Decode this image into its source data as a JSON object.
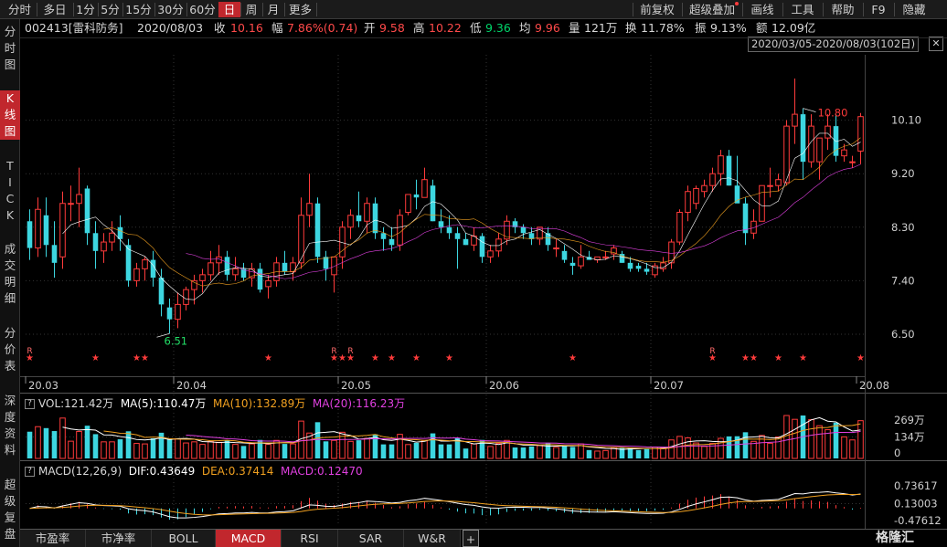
{
  "toolbar": {
    "period_tabs": [
      "分时",
      "多日",
      "1分",
      "5分",
      "15分",
      "30分",
      "60分",
      "日",
      "周",
      "月",
      "更多"
    ],
    "active_tab": "日",
    "right_buttons": [
      "前复权",
      "超级叠加",
      "画线",
      "工具",
      "帮助",
      "F9",
      "隐藏"
    ]
  },
  "sidebar": {
    "groups": [
      "分时图",
      "K线图",
      "TICK",
      "成交明细",
      "分价表",
      "深度资料",
      "超级复盘"
    ],
    "active": "K线图"
  },
  "quote": {
    "code_name": "002413[雷科防务]",
    "date": "2020/08/03",
    "close_label": "收",
    "close": "10.16",
    "change_label": "幅",
    "change": "7.86%(0.74)",
    "open_label": "开",
    "open": "9.58",
    "high_label": "高",
    "high": "10.22",
    "low_label": "低",
    "low": "9.36",
    "avg_label": "均",
    "avg": "9.96",
    "volume_label": "量",
    "volume": "121万",
    "turnover_label": "换",
    "turnover": "11.78%",
    "amplitude_label": "振",
    "amplitude": "9.13%",
    "amount_label": "额",
    "amount": "12.09亿"
  },
  "range_label": "2020/03/05-2020/08/03(102日)",
  "range_close_glyph": "✕",
  "colors": {
    "up": "#ff3b3b",
    "down": "#3dd6e0",
    "ma5": "#ffffff",
    "ma10": "#f0a020",
    "ma20": "#e040e0",
    "dif": "#ffffff",
    "dea": "#f0a020",
    "active": "#c1272d"
  },
  "volume_panel": {
    "toggle": "?",
    "vol": "VOL:121.42万",
    "ma5": "MA(5):110.47万",
    "ma10": "MA(10):132.89万",
    "ma20": "MA(20):116.23万",
    "y_ticks": [
      "269万",
      "134万",
      "0"
    ]
  },
  "macd_panel": {
    "toggle": "?",
    "name": "MACD(12,26,9)",
    "dif": "DIF:0.43649",
    "dea": "DEA:0.37414",
    "macd": "MACD:0.12470",
    "y_ticks": [
      "0.73617",
      "0.13003",
      "-0.47612"
    ]
  },
  "bottom_tabs": [
    "市盈率",
    "市净率",
    "BOLL",
    "MACD",
    "RSI",
    "SAR",
    "W&R"
  ],
  "bottom_active": "MACD",
  "bottom_add_glyph": "+",
  "logo": "格隆汇",
  "chart_data": {
    "type": "candlestick",
    "symbol": "002413",
    "name": "雷科防务",
    "period": "daily",
    "y_ticks": [
      6.5,
      7.4,
      8.3,
      9.2,
      10.1
    ],
    "ylim": [
      5.9,
      11.2
    ],
    "x_tick_labels": [
      {
        "label": "20.03",
        "index": 0
      },
      {
        "label": "20.04",
        "index": 18
      },
      {
        "label": "20.05",
        "index": 38
      },
      {
        "label": "20.06",
        "index": 56
      },
      {
        "label": "20.07",
        "index": 76
      },
      {
        "label": "20.08",
        "index": 101
      }
    ],
    "annotations": [
      {
        "text": "10.80",
        "type": "max",
        "index": 94
      },
      {
        "text": "6.51",
        "type": "min",
        "index": 17
      }
    ],
    "event_markers": [
      {
        "index": 0,
        "text": "R"
      },
      {
        "index": 0,
        "text": "★"
      },
      {
        "index": 8,
        "text": "★"
      },
      {
        "index": 13,
        "text": "★"
      },
      {
        "index": 14,
        "text": "★"
      },
      {
        "index": 29,
        "text": "★"
      },
      {
        "index": 37,
        "text": "R"
      },
      {
        "index": 37,
        "text": "★"
      },
      {
        "index": 38,
        "text": "★"
      },
      {
        "index": 39,
        "text": "R"
      },
      {
        "index": 39,
        "text": "★"
      },
      {
        "index": 42,
        "text": "★"
      },
      {
        "index": 44,
        "text": "★"
      },
      {
        "index": 47,
        "text": "★"
      },
      {
        "index": 51,
        "text": "★"
      },
      {
        "index": 66,
        "text": "★"
      },
      {
        "index": 83,
        "text": "R"
      },
      {
        "index": 83,
        "text": "★"
      },
      {
        "index": 87,
        "text": "★"
      },
      {
        "index": 88,
        "text": "★"
      },
      {
        "index": 91,
        "text": "★"
      },
      {
        "index": 94,
        "text": "★"
      },
      {
        "index": 101,
        "text": "★"
      }
    ],
    "ohlc": [
      [
        8.4,
        8.6,
        7.75,
        7.95
      ],
      [
        7.95,
        8.8,
        7.8,
        8.6
      ],
      [
        8.5,
        8.8,
        7.8,
        8.0
      ],
      [
        8.0,
        8.4,
        7.45,
        7.7
      ],
      [
        7.8,
        8.9,
        7.6,
        8.7
      ],
      [
        8.7,
        9.0,
        8.4,
        8.7
      ],
      [
        8.7,
        9.3,
        8.3,
        8.85
      ],
      [
        8.95,
        9.0,
        8.0,
        8.2
      ],
      [
        8.2,
        8.4,
        7.6,
        7.9
      ],
      [
        7.9,
        8.2,
        7.7,
        8.05
      ],
      [
        8.05,
        8.4,
        7.9,
        8.2
      ],
      [
        8.3,
        8.5,
        7.9,
        8.1
      ],
      [
        8.0,
        8.1,
        7.3,
        7.4
      ],
      [
        7.4,
        7.7,
        7.3,
        7.6
      ],
      [
        7.6,
        7.8,
        7.4,
        7.75
      ],
      [
        7.75,
        7.9,
        7.3,
        7.45
      ],
      [
        7.45,
        7.6,
        6.8,
        7.0
      ],
      [
        6.95,
        7.1,
        6.51,
        6.75
      ],
      [
        6.75,
        7.2,
        6.6,
        7.0
      ],
      [
        7.0,
        7.3,
        6.9,
        7.25
      ],
      [
        7.25,
        7.5,
        7.0,
        7.4
      ],
      [
        7.4,
        7.6,
        7.2,
        7.5
      ],
      [
        7.5,
        7.9,
        7.4,
        7.7
      ],
      [
        7.7,
        8.0,
        7.5,
        7.8
      ],
      [
        7.8,
        7.9,
        7.4,
        7.5
      ],
      [
        7.5,
        7.8,
        7.4,
        7.6
      ],
      [
        7.6,
        7.7,
        7.4,
        7.45
      ],
      [
        7.45,
        7.7,
        7.3,
        7.6
      ],
      [
        7.6,
        7.7,
        7.2,
        7.25
      ],
      [
        7.3,
        7.5,
        7.1,
        7.4
      ],
      [
        7.4,
        7.8,
        7.3,
        7.7
      ],
      [
        7.7,
        7.9,
        7.5,
        7.55
      ],
      [
        7.55,
        7.8,
        7.4,
        7.7
      ],
      [
        7.7,
        8.8,
        7.6,
        8.5
      ],
      [
        8.5,
        9.2,
        8.3,
        8.7
      ],
      [
        8.7,
        8.8,
        7.7,
        7.8
      ],
      [
        7.8,
        7.9,
        7.4,
        7.6
      ],
      [
        7.5,
        7.7,
        7.2,
        7.8
      ],
      [
        7.8,
        8.4,
        7.6,
        8.3
      ],
      [
        8.3,
        8.6,
        8.1,
        8.5
      ],
      [
        8.5,
        8.9,
        8.3,
        8.4
      ],
      [
        8.4,
        8.8,
        8.2,
        8.7
      ],
      [
        8.7,
        8.8,
        8.1,
        8.2
      ],
      [
        8.2,
        8.3,
        7.9,
        8.1
      ],
      [
        8.1,
        8.3,
        7.9,
        8.0
      ],
      [
        8.0,
        8.6,
        7.9,
        8.5
      ],
      [
        8.55,
        8.8,
        8.5,
        8.85
      ],
      [
        8.85,
        9.1,
        8.6,
        8.8
      ],
      [
        8.8,
        9.3,
        8.8,
        9.1
      ],
      [
        9.0,
        9.1,
        8.4,
        8.4
      ],
      [
        8.4,
        8.6,
        8.2,
        8.3
      ],
      [
        8.3,
        8.5,
        8.1,
        8.2
      ],
      [
        8.2,
        8.3,
        7.6,
        8.1
      ],
      [
        8.1,
        8.2,
        8.0,
        8.0
      ],
      [
        8.0,
        8.3,
        7.9,
        8.15
      ],
      [
        8.15,
        8.2,
        7.7,
        7.8
      ],
      [
        7.8,
        8.0,
        7.7,
        7.9
      ],
      [
        7.9,
        8.2,
        7.8,
        8.1
      ],
      [
        8.1,
        8.5,
        8.0,
        8.4
      ],
      [
        8.4,
        8.45,
        8.2,
        8.3
      ],
      [
        8.3,
        8.35,
        8.1,
        8.2
      ],
      [
        8.2,
        8.3,
        8.0,
        8.1
      ],
      [
        8.1,
        8.3,
        8.0,
        8.3
      ],
      [
        8.2,
        8.3,
        7.9,
        8.0
      ],
      [
        7.95,
        8.1,
        7.8,
        7.95
      ],
      [
        7.9,
        8.0,
        7.7,
        7.75
      ],
      [
        7.7,
        7.8,
        7.5,
        7.65
      ],
      [
        7.65,
        8.0,
        7.6,
        7.8
      ],
      [
        7.8,
        7.9,
        7.75,
        7.75
      ],
      [
        7.75,
        7.8,
        7.7,
        7.8
      ],
      [
        7.8,
        7.9,
        7.75,
        7.8
      ],
      [
        7.85,
        8.0,
        7.75,
        7.95
      ],
      [
        7.85,
        7.9,
        7.7,
        7.7
      ],
      [
        7.7,
        7.8,
        7.55,
        7.6
      ],
      [
        7.65,
        7.7,
        7.55,
        7.6
      ],
      [
        7.6,
        7.7,
        7.5,
        7.55
      ],
      [
        7.5,
        7.7,
        7.45,
        7.65
      ],
      [
        7.6,
        7.8,
        7.55,
        7.7
      ],
      [
        7.7,
        8.1,
        7.6,
        8.05
      ],
      [
        8.05,
        8.6,
        8.0,
        8.55
      ],
      [
        8.55,
        9.0,
        8.4,
        8.9
      ],
      [
        8.7,
        9.0,
        8.6,
        8.95
      ],
      [
        8.9,
        9.1,
        8.8,
        9.0
      ],
      [
        9.0,
        9.3,
        8.9,
        9.2
      ],
      [
        9.2,
        9.6,
        9.0,
        9.5
      ],
      [
        9.5,
        9.6,
        9.0,
        9.0
      ],
      [
        9.0,
        9.5,
        8.8,
        8.7
      ],
      [
        8.7,
        8.8,
        8.0,
        8.2
      ],
      [
        8.2,
        8.6,
        8.1,
        8.4
      ],
      [
        8.4,
        9.0,
        8.4,
        9.0
      ],
      [
        9.0,
        9.3,
        8.8,
        9.0
      ],
      [
        9.0,
        9.2,
        8.9,
        9.1
      ],
      [
        9.05,
        10.1,
        9.0,
        10.0
      ],
      [
        10.0,
        10.8,
        9.7,
        10.2
      ],
      [
        10.2,
        10.3,
        9.1,
        9.4
      ],
      [
        9.4,
        10.2,
        9.3,
        10.0
      ],
      [
        9.4,
        9.8,
        9.1,
        9.8
      ],
      [
        9.8,
        10.2,
        9.6,
        10.0
      ],
      [
        10.0,
        10.2,
        9.4,
        9.5
      ],
      [
        9.5,
        9.7,
        9.4,
        9.6
      ],
      [
        9.4,
        9.5,
        9.3,
        9.4
      ],
      [
        9.58,
        10.22,
        9.36,
        10.16
      ]
    ]
  }
}
